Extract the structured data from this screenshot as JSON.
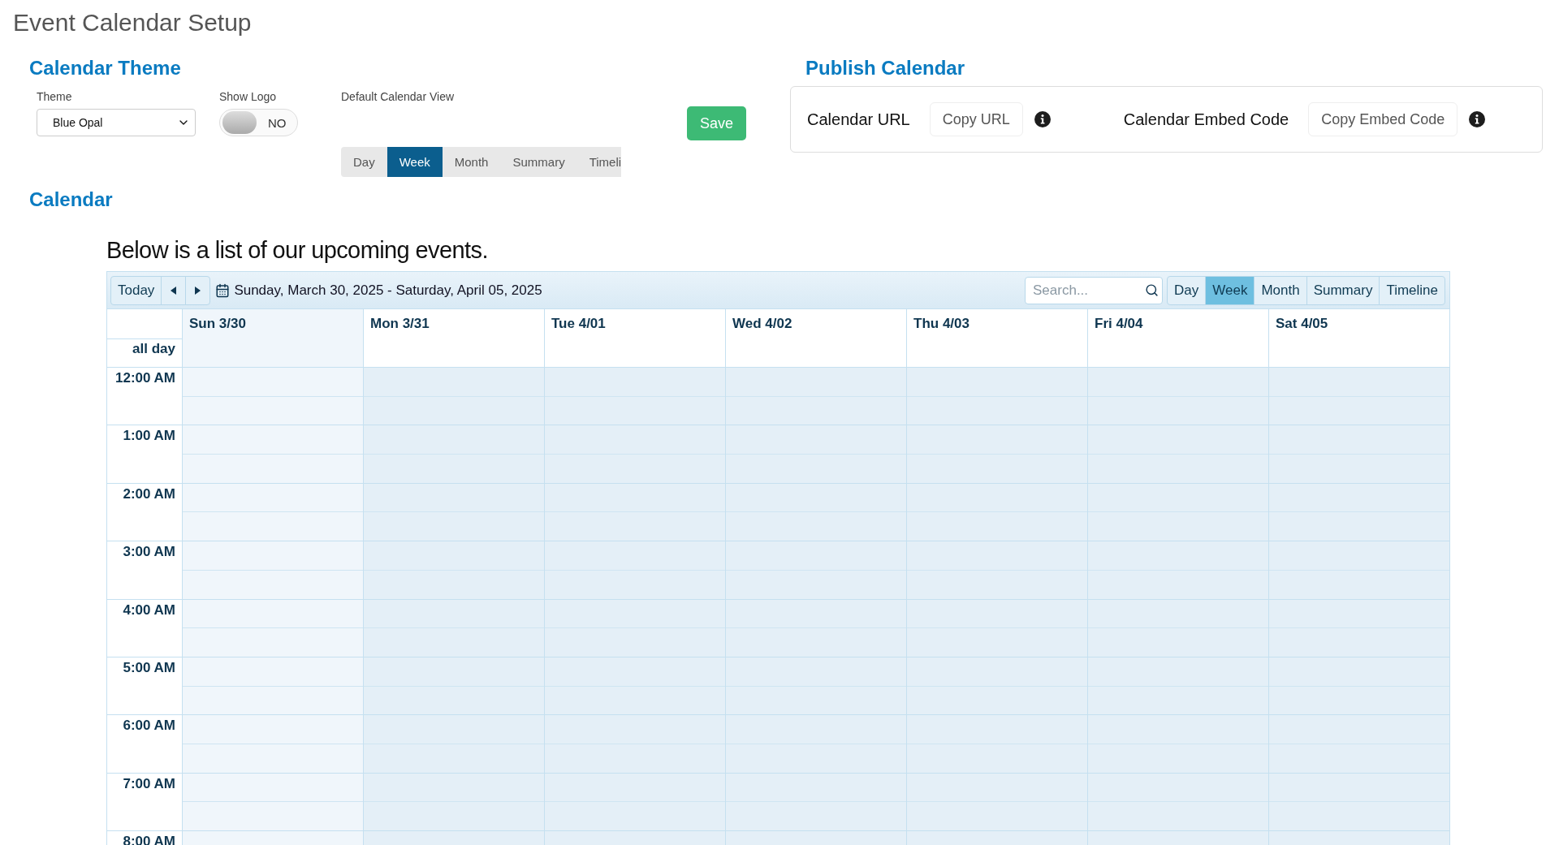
{
  "page_title": "Event Calendar Setup",
  "theme_section": {
    "heading": "Calendar Theme",
    "theme": {
      "label": "Theme",
      "value": "Blue Opal"
    },
    "show_logo": {
      "label": "Show Logo",
      "on": false,
      "state_text": "NO"
    },
    "default_view": {
      "label": "Default Calendar View",
      "options": [
        {
          "label": "Day",
          "selected": false
        },
        {
          "label": "Week",
          "selected": true
        },
        {
          "label": "Month",
          "selected": false
        },
        {
          "label": "Summary",
          "selected": false
        },
        {
          "label": "Timeli",
          "selected": false
        }
      ]
    },
    "save_button": "Save"
  },
  "publish_section": {
    "heading": "Publish Calendar",
    "items": [
      {
        "label": "Calendar URL",
        "button": "Copy URL"
      },
      {
        "label": "Calendar Embed Code",
        "button": "Copy Embed Code"
      }
    ]
  },
  "calendar_section": {
    "heading": "Calendar",
    "intro": "Below is a list of our upcoming events.",
    "toolbar": {
      "today": "Today",
      "date_range": "Sunday, March 30, 2025 - Saturday, April 05, 2025",
      "search_placeholder": "Search...",
      "views": [
        {
          "label": "Day",
          "selected": false
        },
        {
          "label": "Week",
          "selected": true
        },
        {
          "label": "Month",
          "selected": false
        },
        {
          "label": "Summary",
          "selected": false
        },
        {
          "label": "Timeline",
          "selected": false
        }
      ]
    },
    "columns": [
      "Sun 3/30",
      "Mon 3/31",
      "Tue 4/01",
      "Wed 4/02",
      "Thu 4/03",
      "Fri 4/04",
      "Sat 4/05"
    ],
    "all_day_label": "all day",
    "times": [
      "12:00 AM",
      "1:00 AM",
      "2:00 AM",
      "3:00 AM",
      "4:00 AM",
      "5:00 AM",
      "6:00 AM",
      "7:00 AM",
      "8:00 AM"
    ]
  }
}
